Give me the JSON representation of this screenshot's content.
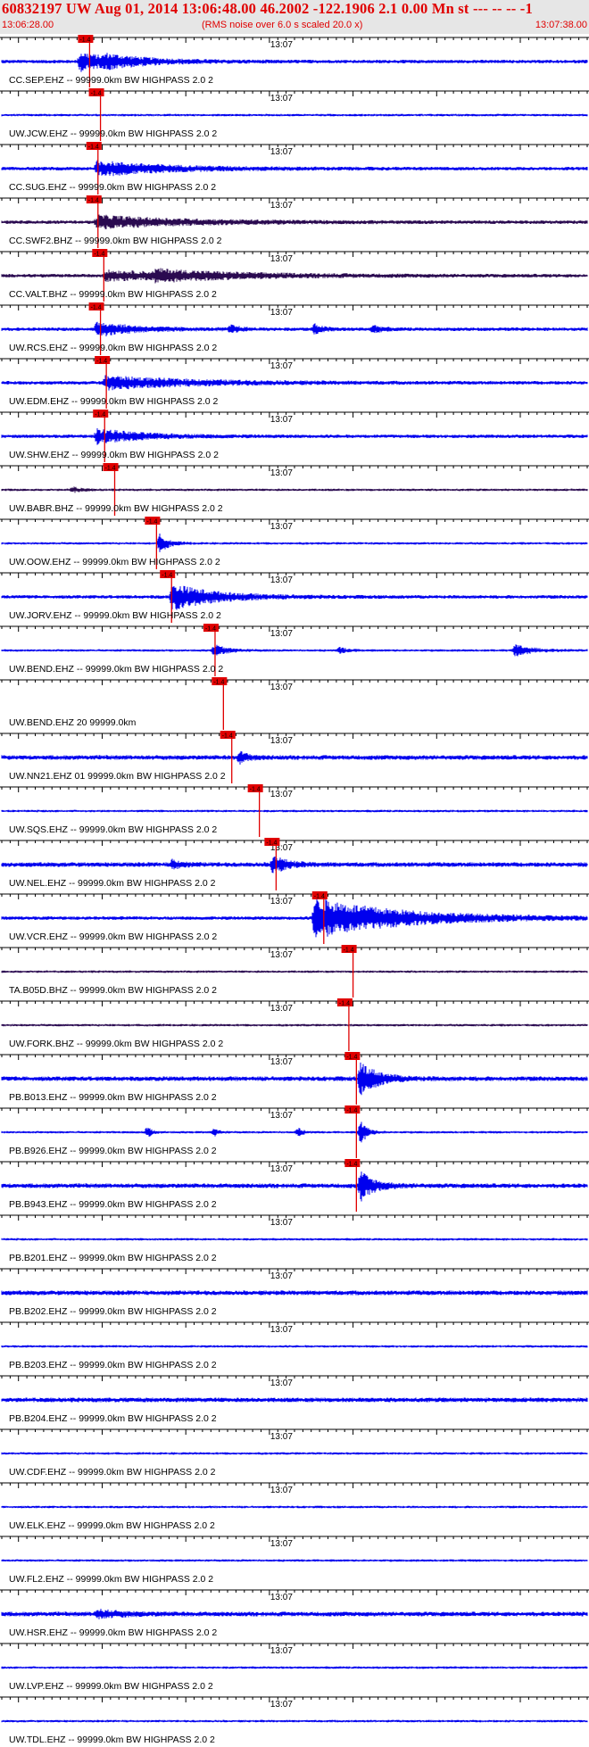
{
  "header": {
    "title": "60832197 UW Aug 01, 2014 13:06:48.00   46.2002 -122.1906  2.1 0.00 Mn st --- -- --  -1",
    "start_time": "13:06:28.00",
    "noise_note": "(RMS noise over 6.0 s scaled 20.0 x)",
    "end_time": "13:07:38.00"
  },
  "colors": {
    "header_bg": "#e6e6e6",
    "header_text": "#e00000",
    "trace_blue": "#0000ee",
    "trace_dark": "#2a0a50",
    "pick": "#e00000",
    "axis": "#000000"
  },
  "chart_data": {
    "type": "line",
    "x_range_s": [
      0,
      70
    ],
    "minute_label": "13:07",
    "minute_mark_s": 32,
    "pick_label": "-1.4",
    "traces": [
      {
        "label": "CC.SEP.EHZ -- 99999.0km BW  HIGHPASS  2.0  2",
        "pick_s": 10.5,
        "style": "burst",
        "color": "blue",
        "bursts": [
          [
            9,
            4,
            10
          ],
          [
            12,
            6,
            4
          ]
        ]
      },
      {
        "label": "UW.JCW.EHZ -- 99999.0km BW  HIGHPASS  2.0  2",
        "pick_s": 11.8,
        "style": "flat",
        "color": "blue",
        "bursts": []
      },
      {
        "label": "CC.SUG.EHZ -- 99999.0km BW  HIGHPASS  2.0  2",
        "pick_s": 11.5,
        "style": "burst",
        "color": "blue",
        "bursts": [
          [
            11,
            8,
            8
          ]
        ]
      },
      {
        "label": "CC.SWF2.BHZ -- 99999.0km BW  HIGHPASS  2.0  2",
        "pick_s": 11.5,
        "style": "burst",
        "color": "dark",
        "bursts": [
          [
            11,
            10,
            7
          ]
        ]
      },
      {
        "label": "CC.VALT.BHZ -- 99999.0km BW  HIGHPASS  2.0  2",
        "pick_s": 12.2,
        "style": "burst",
        "color": "dark",
        "bursts": [
          [
            12,
            12,
            5
          ],
          [
            18,
            8,
            4
          ]
        ]
      },
      {
        "label": "UW.RCS.EHZ -- 99999.0km BW  HIGHPASS  2.0  2",
        "pick_s": 11.8,
        "style": "burst",
        "color": "blue",
        "bursts": [
          [
            11,
            4,
            8
          ],
          [
            27,
            1,
            4
          ],
          [
            37,
            1,
            5
          ],
          [
            44,
            1,
            4
          ]
        ]
      },
      {
        "label": "UW.EDM.EHZ -- 99999.0km BW  HIGHPASS  2.0  2",
        "pick_s": 12.5,
        "style": "burst",
        "color": "blue",
        "bursts": [
          [
            12,
            10,
            7
          ]
        ]
      },
      {
        "label": "UW.SHW.EHZ -- 99999.0km BW  HIGHPASS  2.0  2",
        "pick_s": 12.3,
        "style": "burst",
        "color": "blue",
        "bursts": [
          [
            11,
            5,
            8
          ]
        ]
      },
      {
        "label": "UW.BABR.BHZ -- 99999.0km BW  HIGHPASS  2.0  2",
        "pick_s": 13.5,
        "style": "flat",
        "color": "dark",
        "bursts": [
          [
            8,
            1,
            3
          ]
        ]
      },
      {
        "label": "UW.OOW.EHZ -- 99999.0km BW  HIGHPASS  2.0  2",
        "pick_s": 18.5,
        "style": "flat",
        "color": "blue",
        "bursts": [
          [
            18.5,
            1,
            10
          ]
        ]
      },
      {
        "label": "UW.JORV.EHZ -- 99999.0km BW  HIGHPASS  2.0  2",
        "pick_s": 20.3,
        "style": "burst",
        "color": "blue",
        "bursts": [
          [
            20,
            5,
            14
          ]
        ]
      },
      {
        "label": "UW.BEND.EHZ -- 99999.0km BW  HIGHPASS  2.0  2",
        "pick_s": 25.5,
        "style": "flat",
        "color": "blue",
        "bursts": [
          [
            25,
            1.5,
            6
          ],
          [
            40,
            1,
            3
          ],
          [
            61,
            2,
            6
          ]
        ]
      },
      {
        "label": "UW.BEND.EHZ 20 99999.0km",
        "pick_s": 26.5,
        "style": "none",
        "color": "blue",
        "bursts": []
      },
      {
        "label": "UW.NN21.EHZ 01 99999.0km BW  HIGHPASS  2.0  2",
        "pick_s": 27.5,
        "style": "noisy",
        "color": "blue",
        "bursts": [
          [
            28,
            1,
            6
          ]
        ]
      },
      {
        "label": "UW.SQS.EHZ -- 99999.0km BW  HIGHPASS  2.0  2",
        "pick_s": 30.8,
        "style": "flat",
        "color": "blue",
        "bursts": []
      },
      {
        "label": "UW.NEL.EHZ -- 99999.0km BW  HIGHPASS  2.0  2",
        "pick_s": 32.8,
        "style": "noisy",
        "color": "blue",
        "bursts": [
          [
            20,
            1,
            5
          ],
          [
            32,
            1.5,
            10
          ]
        ]
      },
      {
        "label": "UW.VCR.EHZ -- 99999.0km BW  HIGHPASS  2.0  2",
        "pick_s": 38.5,
        "style": "burst",
        "color": "blue",
        "bursts": [
          [
            37,
            10,
            22
          ]
        ]
      },
      {
        "label": "TA.B05D.BHZ -- 99999.0km BW  HIGHPASS  2.0  2",
        "pick_s": 42,
        "style": "flat",
        "color": "dark",
        "bursts": []
      },
      {
        "label": "UW.FORK.BHZ -- 99999.0km BW  HIGHPASS  2.0  2",
        "pick_s": 41.5,
        "style": "flat",
        "color": "dark",
        "bursts": []
      },
      {
        "label": "PB.B013.EHZ -- 99999.0km BW  HIGHPASS  2.0  2",
        "pick_s": 42.4,
        "style": "noisy",
        "color": "blue",
        "bursts": [
          [
            42.5,
            2,
            18
          ]
        ]
      },
      {
        "label": "PB.B926.EHZ -- 99999.0km BW  HIGHPASS  2.0  2",
        "pick_s": 42.4,
        "style": "flat",
        "color": "blue",
        "bursts": [
          [
            17,
            0.5,
            6
          ],
          [
            25,
            0.5,
            4
          ],
          [
            35,
            0.5,
            5
          ],
          [
            42.5,
            0.7,
            14
          ]
        ]
      },
      {
        "label": "PB.B943.EHZ -- 99999.0km BW  HIGHPASS  2.0  2",
        "pick_s": 42.4,
        "style": "noisy",
        "color": "blue",
        "bursts": [
          [
            42.5,
            1.5,
            16
          ]
        ]
      },
      {
        "label": "PB.B201.EHZ -- 99999.0km BW  HIGHPASS  2.0  2",
        "pick_s": null,
        "style": "flat",
        "color": "blue",
        "bursts": []
      },
      {
        "label": "PB.B202.EHZ -- 99999.0km BW  HIGHPASS  2.0  2",
        "pick_s": null,
        "style": "noisy",
        "color": "blue",
        "bursts": []
      },
      {
        "label": "PB.B203.EHZ -- 99999.0km BW  HIGHPASS  2.0  2",
        "pick_s": null,
        "style": "flat",
        "color": "blue",
        "bursts": []
      },
      {
        "label": "PB.B204.EHZ -- 99999.0km BW  HIGHPASS  2.0  2",
        "pick_s": null,
        "style": "noisy",
        "color": "blue",
        "bursts": []
      },
      {
        "label": "UW.CDF.EHZ -- 99999.0km BW  HIGHPASS  2.0  2",
        "pick_s": null,
        "style": "flat",
        "color": "blue",
        "bursts": []
      },
      {
        "label": "UW.ELK.EHZ -- 99999.0km BW  HIGHPASS  2.0  2",
        "pick_s": null,
        "style": "flat",
        "color": "blue",
        "bursts": []
      },
      {
        "label": "UW.FL2.EHZ -- 99999.0km BW  HIGHPASS  2.0  2",
        "pick_s": null,
        "style": "flat",
        "color": "blue",
        "bursts": []
      },
      {
        "label": "UW.HSR.EHZ -- 99999.0km BW  HIGHPASS  2.0  2",
        "pick_s": null,
        "style": "noisy",
        "color": "blue",
        "bursts": [
          [
            11,
            3,
            4
          ]
        ]
      },
      {
        "label": "UW.LVP.EHZ -- 99999.0km BW  HIGHPASS  2.0  2",
        "pick_s": null,
        "style": "flat",
        "color": "blue",
        "bursts": []
      },
      {
        "label": "UW.TDL.EHZ -- 99999.0km BW  HIGHPASS  2.0  2",
        "pick_s": null,
        "style": "flat",
        "color": "blue",
        "bursts": []
      }
    ]
  }
}
